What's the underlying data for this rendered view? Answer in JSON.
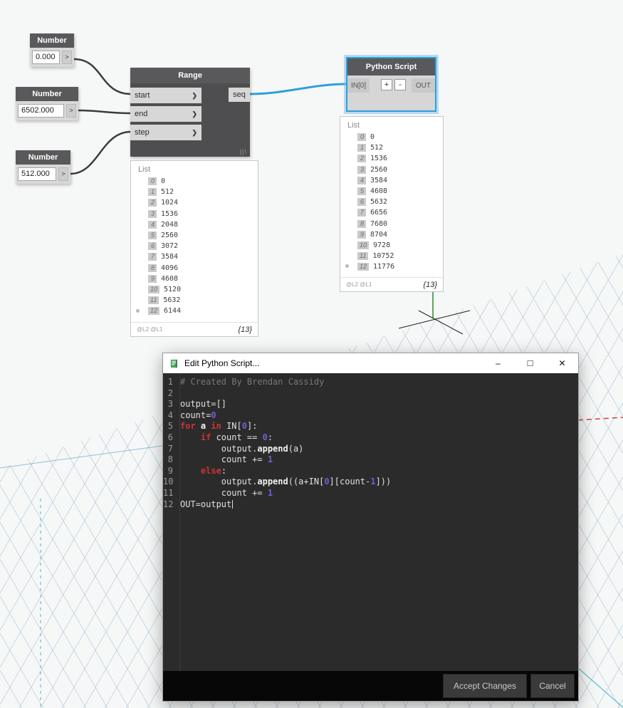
{
  "canvas": {
    "number_nodes": [
      {
        "title": "Number",
        "value": "0.000",
        "out_port": ">"
      },
      {
        "title": "Number",
        "value": "6502.000",
        "out_port": ">"
      },
      {
        "title": "Number",
        "value": "512.000",
        "out_port": ">"
      }
    ],
    "range_node": {
      "title": "Range",
      "inputs": [
        "start",
        "end",
        "step"
      ],
      "chevron": "❯",
      "output": "seq",
      "resize_glyph": "||\\"
    },
    "python_node": {
      "title": "Python Script",
      "input": "IN[0]",
      "add_label": "+",
      "remove_label": "-",
      "output": "OUT"
    },
    "list_previews": [
      {
        "label": "List",
        "rows": [
          {
            "index": "0",
            "value": "0"
          },
          {
            "index": "1",
            "value": "512"
          },
          {
            "index": "2",
            "value": "1024"
          },
          {
            "index": "3",
            "value": "1536"
          },
          {
            "index": "4",
            "value": "2048"
          },
          {
            "index": "5",
            "value": "2560"
          },
          {
            "index": "6",
            "value": "3072"
          },
          {
            "index": "7",
            "value": "3584"
          },
          {
            "index": "8",
            "value": "4096"
          },
          {
            "index": "9",
            "value": "4608"
          },
          {
            "index": "10",
            "value": "5120"
          },
          {
            "index": "11",
            "value": "5632"
          },
          {
            "index": "12",
            "value": "6144"
          }
        ],
        "levels": "@L2 @L1",
        "count": "{13}"
      },
      {
        "label": "List",
        "rows": [
          {
            "index": "0",
            "value": "0"
          },
          {
            "index": "1",
            "value": "512"
          },
          {
            "index": "2",
            "value": "1536"
          },
          {
            "index": "3",
            "value": "2560"
          },
          {
            "index": "4",
            "value": "3584"
          },
          {
            "index": "5",
            "value": "4608"
          },
          {
            "index": "6",
            "value": "5632"
          },
          {
            "index": "7",
            "value": "6656"
          },
          {
            "index": "8",
            "value": "7680"
          },
          {
            "index": "9",
            "value": "8704"
          },
          {
            "index": "10",
            "value": "9728"
          },
          {
            "index": "11",
            "value": "10752"
          },
          {
            "index": "12",
            "value": "11776"
          }
        ],
        "levels": "@L2 @L1",
        "count": "{13}"
      }
    ]
  },
  "editor": {
    "title": "Edit Python Script...",
    "window_buttons": {
      "minimize": "–",
      "maximize": "□",
      "close": "✕"
    },
    "lines": [
      {
        "n": "1",
        "tokens": [
          [
            "cm",
            "# Created By Brendan Cassidy"
          ]
        ]
      },
      {
        "n": "2",
        "tokens": []
      },
      {
        "n": "3",
        "tokens": [
          [
            "pl",
            "output=[]"
          ]
        ]
      },
      {
        "n": "4",
        "tokens": [
          [
            "pl",
            "count="
          ],
          [
            "num",
            "0"
          ]
        ]
      },
      {
        "n": "5",
        "tokens": [
          [
            "kw",
            "for"
          ],
          [
            "pl",
            " "
          ],
          [
            "bd",
            "a"
          ],
          [
            "pl",
            " "
          ],
          [
            "kw",
            "in"
          ],
          [
            "pl",
            " IN["
          ],
          [
            "num",
            "0"
          ],
          [
            "pl",
            "]:"
          ]
        ]
      },
      {
        "n": "6",
        "tokens": [
          [
            "pl",
            "    "
          ],
          [
            "kw",
            "if"
          ],
          [
            "pl",
            " count == "
          ],
          [
            "num",
            "0"
          ],
          [
            "pl",
            ":"
          ]
        ]
      },
      {
        "n": "7",
        "tokens": [
          [
            "pl",
            "        output."
          ],
          [
            "bd",
            "append"
          ],
          [
            "pl",
            "(a)"
          ]
        ]
      },
      {
        "n": "8",
        "tokens": [
          [
            "pl",
            "        count += "
          ],
          [
            "num",
            "1"
          ]
        ]
      },
      {
        "n": "9",
        "tokens": [
          [
            "pl",
            "    "
          ],
          [
            "kw",
            "else"
          ],
          [
            "pl",
            ":"
          ]
        ]
      },
      {
        "n": "10",
        "tokens": [
          [
            "pl",
            "        output."
          ],
          [
            "bd",
            "append"
          ],
          [
            "pl",
            "((a+IN["
          ],
          [
            "num",
            "0"
          ],
          [
            "pl",
            "][count-"
          ],
          [
            "num",
            "1"
          ],
          [
            "pl",
            "]))"
          ]
        ]
      },
      {
        "n": "11",
        "tokens": [
          [
            "pl",
            "        count += "
          ],
          [
            "num",
            "1"
          ]
        ]
      },
      {
        "n": "12",
        "tokens": [
          [
            "pl",
            "OUT=output"
          ],
          [
            "caret",
            ""
          ]
        ]
      }
    ],
    "accept_label": "Accept Changes",
    "cancel_label": "Cancel"
  },
  "colors": {
    "selection_blue": "#2d9fd8",
    "wire_gray": "#3c3c3e",
    "keyword_red": "#cc3434",
    "number_purple": "#7a5ad5",
    "comment_gray": "#787878"
  }
}
